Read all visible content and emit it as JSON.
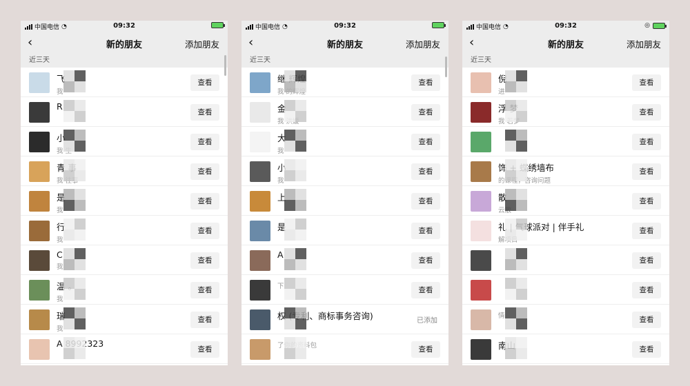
{
  "status": {
    "carrier": "中国电信",
    "time": "09:32"
  },
  "nav": {
    "back_icon": "chevron-left-icon",
    "title": "新的朋友",
    "action": "添加朋友"
  },
  "section_label": "近三天",
  "view_label": "查看",
  "added_label": "已添加",
  "colors": {
    "background": "#e2dad8",
    "nav_bg": "#ededed",
    "button_bg": "#f2f2f2",
    "battery": "#5fd35f"
  },
  "phones": [
    {
      "rows": [
        {
          "name": "飞",
          "sub": "我",
          "action": "view"
        },
        {
          "name": "R",
          "sub": "",
          "action": "view"
        },
        {
          "name": "小",
          "sub": "我          生",
          "action": "view"
        },
        {
          "name": "青           事",
          "sub": "我        往事",
          "action": "view"
        },
        {
          "name": "是",
          "sub": "我",
          "action": "view"
        },
        {
          "name": "行",
          "sub": "我",
          "action": "view"
        },
        {
          "name": "C",
          "sub": "我",
          "action": "view"
        },
        {
          "name": "温          。",
          "sub": "我",
          "action": "view"
        },
        {
          "name": "瑞",
          "sub": "我",
          "action": "view"
        },
        {
          "name": "A                    8992323",
          "sub": "",
          "action": "view"
        }
      ]
    },
    {
      "rows": [
        {
          "name": "继         辉煌",
          "sub": "我          的辉煌",
          "action": "view"
        },
        {
          "name": "金",
          "sub": "我          洪媛",
          "action": "view"
        },
        {
          "name": "大",
          "sub": "我",
          "action": "view"
        },
        {
          "name": "小",
          "sub": "我",
          "action": "view"
        },
        {
          "name": "上",
          "sub": "",
          "action": "view"
        },
        {
          "name": "是",
          "sub": "",
          "action": "view"
        },
        {
          "name": "A",
          "sub": "",
          "action": "view"
        },
        {
          "name": "",
          "sub": "下",
          "action": "view"
        },
        {
          "name": "         权 (专利、商标事务咨询)",
          "sub": "",
          "action": "added"
        },
        {
          "name": "",
          "sub": "了你的资料包",
          "action": "view"
        }
      ]
    },
    {
      "rows": [
        {
          "name": "倪",
          "sub": "进",
          "action": "view"
        },
        {
          "name": "浮        梦",
          "sub": "我       若梦",
          "action": "view"
        },
        {
          "name": "",
          "sub": "",
          "action": "view"
        },
        {
          "name": "         饰 + 蝶绣墙布",
          "sub": "        的课程，咨询问题",
          "action": "view"
        },
        {
          "name": "         散",
          "sub": "         云散",
          "action": "view"
        },
        {
          "name": "         礼 | 气球派对 | 伴手礼",
          "sub": "         解项目",
          "action": "view"
        },
        {
          "name": "",
          "sub": "",
          "action": "view"
        },
        {
          "name": "",
          "sub": "",
          "action": "view"
        },
        {
          "name": "",
          "sub": "         情",
          "action": "view"
        },
        {
          "name": "         南山",
          "sub": "",
          "action": "view"
        }
      ]
    }
  ]
}
